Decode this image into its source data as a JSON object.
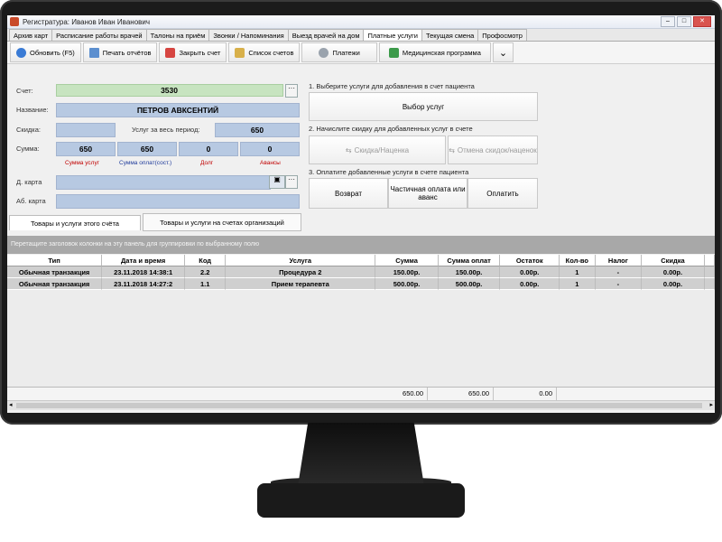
{
  "window": {
    "title": "Регистратура: Иванов Иван Иванович",
    "buttons": [
      "–",
      "□",
      "✕"
    ]
  },
  "tabs": [
    "Архив карт",
    "Расписание работы врачей",
    "Талоны на приём",
    "Звонки / Напоминания",
    "Выезд врачей на дом",
    "Платные услуги",
    "Текущая смена",
    "Профосмотр"
  ],
  "active_tab": "Платные услуги",
  "toolbar": {
    "refresh": "Обновить (F5)",
    "print": "Печать отчётов",
    "close_bill": "Закрыть счет",
    "bills_list": "Список счетов",
    "payments": "Платежи",
    "medical_program": "Медицинская программа",
    "more": "⌄"
  },
  "form": {
    "bill_label": "Счет:",
    "bill_value": "3530",
    "name_label": "Название:",
    "name_value": "ПЕТРОВ АВКСЕНТИЙ",
    "discount_label": "Скидка:",
    "discount_value": "",
    "period_label": "Услуг за весь период:",
    "period_value": "650",
    "sum_label": "Сумма:",
    "sums": [
      "650",
      "650",
      "0",
      "0"
    ],
    "sum_captions": [
      "Сумма услуг",
      "Сумма оплат(сост.)",
      "Долг",
      "Авансы"
    ],
    "dcard_label": "Д. карта",
    "dcard_value": "",
    "abcard_label": "Аб. карта",
    "abcard_value": "",
    "dots": "···"
  },
  "subtabs": [
    "Товары и услуги этого счёта",
    "Товары и услуги на счетах организаций"
  ],
  "right_panel": {
    "step1": "1. Выберите услуги для добавления в счет пациента",
    "select_services": "Выбор услуг",
    "step2": "2. Начислите скидку для добавленных услуг в счете",
    "discount_markup": "Скидка/Наценка",
    "cancel_discounts": "Отмена скидок/наценок",
    "step3": "3. Оплатите добавленные услуги в счете пациента",
    "refund": "Возврат",
    "partial_payment": "Частичная оплата или аванс",
    "pay": "Оплатить"
  },
  "grid": {
    "group_hint": "Перетащите заголовок колонки на эту панель для группировки по выбранному полю",
    "columns": [
      "Тип",
      "Дата и время",
      "Код",
      "Услуга",
      "Сумма",
      "Сумма оплат",
      "Остаток",
      "Кол-во",
      "Налог",
      "Скидка"
    ],
    "rows": [
      [
        "Обычная транзакция",
        "23.11.2018 14:38:1",
        "2.2",
        "Процедура 2",
        "150.00р.",
        "150.00р.",
        "0.00р.",
        "1",
        "-",
        "0.00р."
      ],
      [
        "Обычная транзакция",
        "23.11.2018 14:27:2",
        "1.1",
        "Прием терапевта",
        "500.00р.",
        "500.00р.",
        "0.00р.",
        "1",
        "-",
        "0.00р."
      ]
    ],
    "totals": [
      "650.00",
      "650.00",
      "0.00"
    ]
  }
}
